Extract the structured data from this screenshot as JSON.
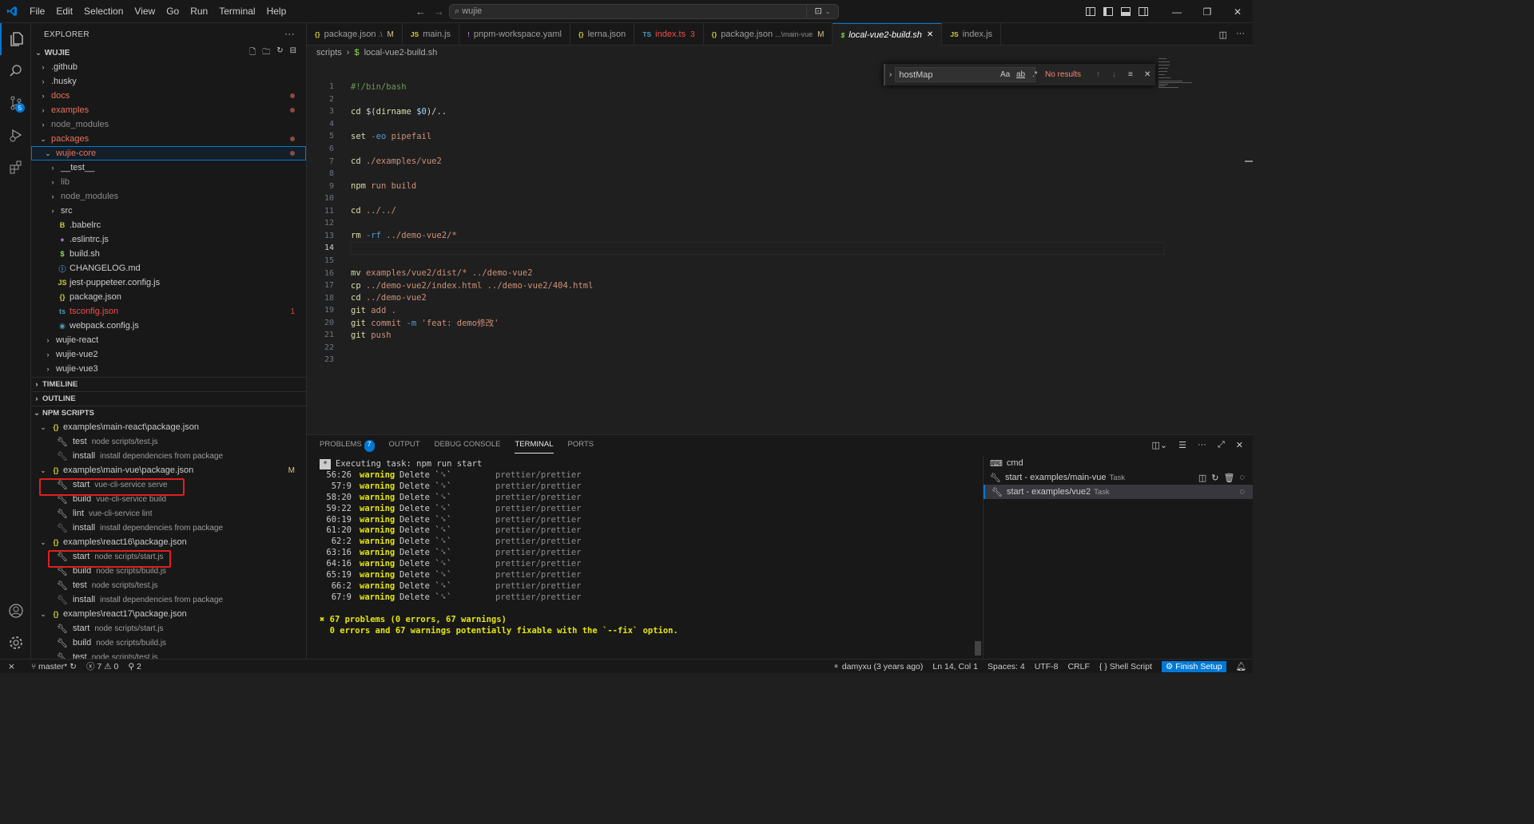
{
  "menu": [
    "File",
    "Edit",
    "Selection",
    "View",
    "Go",
    "Run",
    "Terminal",
    "Help"
  ],
  "command_center": "wujie",
  "explorer": {
    "title": "EXPLORER",
    "root": "WUJIE",
    "items": [
      {
        "label": ".github",
        "chev": ">",
        "indent": 0
      },
      {
        "label": ".husky",
        "chev": ">",
        "indent": 0
      },
      {
        "label": "docs",
        "chev": ">",
        "indent": 0,
        "modified": true
      },
      {
        "label": "examples",
        "chev": ">",
        "indent": 0,
        "modified": true
      },
      {
        "label": "node_modules",
        "chev": ">",
        "indent": 0,
        "dim": true
      },
      {
        "label": "packages",
        "chev": "v",
        "indent": 0,
        "modified": true
      },
      {
        "label": "wujie-core",
        "chev": "v",
        "indent": 1,
        "modified": true,
        "selected": true
      },
      {
        "label": "__test__",
        "chev": ">",
        "indent": 2
      },
      {
        "label": "lib",
        "chev": ">",
        "indent": 2,
        "dim": true
      },
      {
        "label": "node_modules",
        "chev": ">",
        "indent": 2,
        "dim": true
      },
      {
        "label": "src",
        "chev": ">",
        "indent": 2
      },
      {
        "label": ".babelrc",
        "icon": "B",
        "iconColor": "#cbcb41",
        "indent": 2
      },
      {
        "label": ".eslintrc.js",
        "icon": "●",
        "iconColor": "#a074c4",
        "indent": 2
      },
      {
        "label": "build.sh",
        "icon": "$",
        "iconColor": "#89e051",
        "indent": 2
      },
      {
        "label": "CHANGELOG.md",
        "icon": "ⓘ",
        "iconColor": "#519aba",
        "indent": 2
      },
      {
        "label": "jest-puppeteer.config.js",
        "icon": "JS",
        "iconColor": "#cbcb41",
        "indent": 2
      },
      {
        "label": "package.json",
        "icon": "{}",
        "iconColor": "#cbcb41",
        "indent": 2
      },
      {
        "label": "tsconfig.json",
        "icon": "ts",
        "iconColor": "#519aba",
        "indent": 2,
        "error": "1"
      },
      {
        "label": "webpack.config.js",
        "icon": "◉",
        "iconColor": "#519aba",
        "indent": 2
      },
      {
        "label": "wujie-react",
        "chev": ">",
        "indent": 1
      },
      {
        "label": "wujie-vue2",
        "chev": ">",
        "indent": 1
      },
      {
        "label": "wujie-vue3",
        "chev": ">",
        "indent": 1
      }
    ]
  },
  "sections": {
    "timeline": "TIMELINE",
    "outline": "OUTLINE",
    "npm": "NPM SCRIPTS"
  },
  "npm_scripts": [
    {
      "pkg": "examples\\main-react\\package.json",
      "status": "",
      "scripts": [
        {
          "name": "test",
          "cmd": "node scripts/test.js"
        },
        {
          "name": "install",
          "cmd": "install dependencies from package",
          "dim": true
        }
      ]
    },
    {
      "pkg": "examples\\main-vue\\package.json",
      "status": "M",
      "scripts": [
        {
          "name": "start",
          "cmd": "vue-cli-service serve",
          "highlight": true
        },
        {
          "name": "build",
          "cmd": "vue-cli-service build"
        },
        {
          "name": "lint",
          "cmd": "vue-cli-service lint"
        },
        {
          "name": "install",
          "cmd": "install dependencies from package",
          "dim": true
        }
      ]
    },
    {
      "pkg": "examples\\react16\\package.json",
      "status": "",
      "scripts": [
        {
          "name": "start",
          "cmd": "node scripts/start.js",
          "highlight": true
        },
        {
          "name": "build",
          "cmd": "node scripts/build.js"
        },
        {
          "name": "test",
          "cmd": "node scripts/test.js"
        },
        {
          "name": "install",
          "cmd": "install dependencies from package",
          "dim": true
        }
      ]
    },
    {
      "pkg": "examples\\react17\\package.json",
      "status": "",
      "scripts": [
        {
          "name": "start",
          "cmd": "node scripts/start.js"
        },
        {
          "name": "build",
          "cmd": "node scripts/build.js"
        },
        {
          "name": "test",
          "cmd": "node scripts/test.js"
        }
      ]
    }
  ],
  "tabs": [
    {
      "icon": "{}",
      "iconColor": "#cbcb41",
      "label": "package.json",
      "sub": ".\\",
      "mark": "M",
      "markColor": "#e2c08d"
    },
    {
      "icon": "JS",
      "iconColor": "#cbcb41",
      "label": "main.js"
    },
    {
      "icon": "!",
      "iconColor": "#a074c4",
      "label": "pnpm-workspace.yaml"
    },
    {
      "icon": "{}",
      "iconColor": "#cbcb41",
      "label": "lerna.json"
    },
    {
      "icon": "TS",
      "iconColor": "#519aba",
      "label": "index.ts",
      "mark": "3",
      "markColor": "#f14c4c",
      "labelColor": "#f14c4c"
    },
    {
      "icon": "{}",
      "iconColor": "#cbcb41",
      "label": "package.json",
      "sub": "...\\main-vue",
      "mark": "M",
      "markColor": "#e2c08d"
    },
    {
      "icon": "$",
      "iconColor": "#89e051",
      "label": "local-vue2-build.sh",
      "active": true,
      "mark": "✕",
      "markColor": "#ffffff"
    },
    {
      "icon": "JS",
      "iconColor": "#cbcb41",
      "label": "index.js"
    }
  ],
  "breadcrumb": [
    "scripts",
    "local-vue2-build.sh"
  ],
  "find": {
    "value": "hostMap",
    "result": "No results",
    "case": "Aa",
    "word": "ab",
    "regex": ".*"
  },
  "code": [
    {
      "n": "1",
      "segs": [
        {
          "t": "#!/bin/bash",
          "c": "cm"
        }
      ]
    },
    {
      "n": "2",
      "segs": []
    },
    {
      "n": "3",
      "segs": [
        {
          "t": "cd ",
          "c": "fn"
        },
        {
          "t": "$(",
          "c": "op"
        },
        {
          "t": "dirname ",
          "c": "fn"
        },
        {
          "t": "$0",
          "c": "vr"
        },
        {
          "t": ")/..",
          "c": "op"
        }
      ]
    },
    {
      "n": "4",
      "segs": []
    },
    {
      "n": "5",
      "segs": [
        {
          "t": "set ",
          "c": "fn"
        },
        {
          "t": "-eo ",
          "c": "kw"
        },
        {
          "t": "pipefail",
          "c": "str"
        }
      ]
    },
    {
      "n": "6",
      "segs": []
    },
    {
      "n": "7",
      "segs": [
        {
          "t": "cd ",
          "c": "fn"
        },
        {
          "t": "./examples/vue2",
          "c": "str"
        }
      ]
    },
    {
      "n": "8",
      "segs": []
    },
    {
      "n": "9",
      "segs": [
        {
          "t": "npm ",
          "c": "fn"
        },
        {
          "t": "run build",
          "c": "str"
        }
      ]
    },
    {
      "n": "10",
      "segs": []
    },
    {
      "n": "11",
      "segs": [
        {
          "t": "cd ",
          "c": "fn"
        },
        {
          "t": "../../",
          "c": "str"
        }
      ]
    },
    {
      "n": "12",
      "segs": []
    },
    {
      "n": "13",
      "segs": [
        {
          "t": "rm ",
          "c": "fn"
        },
        {
          "t": "-rf ",
          "c": "kw"
        },
        {
          "t": "../demo-vue2/*",
          "c": "str"
        }
      ]
    },
    {
      "n": "14",
      "segs": [],
      "current": true
    },
    {
      "n": "15",
      "segs": []
    },
    {
      "n": "16",
      "segs": [
        {
          "t": "mv ",
          "c": "fn"
        },
        {
          "t": "examples/vue2/dist/* ../demo-vue2",
          "c": "str"
        }
      ]
    },
    {
      "n": "17",
      "segs": [
        {
          "t": "cp ",
          "c": "fn"
        },
        {
          "t": "../demo-vue2/index.html ../demo-vue2/404.html",
          "c": "str"
        }
      ]
    },
    {
      "n": "18",
      "segs": [
        {
          "t": "cd ",
          "c": "fn"
        },
        {
          "t": "../demo-vue2",
          "c": "str"
        }
      ]
    },
    {
      "n": "19",
      "segs": [
        {
          "t": "git ",
          "c": "fn"
        },
        {
          "t": "add .",
          "c": "str"
        }
      ]
    },
    {
      "n": "20",
      "segs": [
        {
          "t": "git ",
          "c": "fn"
        },
        {
          "t": "commit ",
          "c": "str"
        },
        {
          "t": "-m ",
          "c": "kw"
        },
        {
          "t": "'feat: demo修改'",
          "c": "str"
        }
      ]
    },
    {
      "n": "21",
      "segs": [
        {
          "t": "git ",
          "c": "fn"
        },
        {
          "t": "push",
          "c": "str"
        }
      ]
    },
    {
      "n": "22",
      "segs": []
    },
    {
      "n": "23",
      "segs": []
    }
  ],
  "panel": {
    "tabs": [
      {
        "label": "PROBLEMS",
        "badge": "7"
      },
      {
        "label": "OUTPUT"
      },
      {
        "label": "DEBUG CONSOLE"
      },
      {
        "label": "TERMINAL",
        "active": true
      },
      {
        "label": "PORTS"
      }
    ],
    "task_header": "Executing task: npm run start",
    "warnings": [
      {
        "pos": "56:26",
        "rule": "prettier/prettier"
      },
      {
        "pos": "57:9",
        "rule": "prettier/prettier"
      },
      {
        "pos": "58:20",
        "rule": "prettier/prettier"
      },
      {
        "pos": "59:22",
        "rule": "prettier/prettier"
      },
      {
        "pos": "60:19",
        "rule": "prettier/prettier"
      },
      {
        "pos": "61:20",
        "rule": "prettier/prettier"
      },
      {
        "pos": "62:2",
        "rule": "prettier/prettier"
      },
      {
        "pos": "63:16",
        "rule": "prettier/prettier"
      },
      {
        "pos": "64:16",
        "rule": "prettier/prettier"
      },
      {
        "pos": "65:19",
        "rule": "prettier/prettier"
      },
      {
        "pos": "66:2",
        "rule": "prettier/prettier"
      },
      {
        "pos": "67:9",
        "rule": "prettier/prettier"
      }
    ],
    "warning_label": "warning",
    "delete_label": "Delete `␍`",
    "summary1": "✖ 67 problems (0 errors, 67 warnings)",
    "summary2": "  0 errors and 67 warnings potentially fixable with the `--fix` option.",
    "terminals": [
      {
        "label": "cmd",
        "tag": ""
      },
      {
        "label": "start - examples/main-vue",
        "tag": "Task"
      },
      {
        "label": "start - examples/vue2",
        "tag": "Task",
        "selected": true
      }
    ]
  },
  "status": {
    "branch": "master*",
    "errors": "7",
    "warnings": "0",
    "ports": "2",
    "blame": "damyxu (3 years ago)",
    "position": "Ln 14, Col 1",
    "spaces": "Spaces: 4",
    "encoding": "UTF-8",
    "eol": "CRLF",
    "language": "Shell Script",
    "setup": "Finish Setup"
  },
  "colors": {
    "accent": "#0078d4",
    "warning": "#e5e510",
    "highlight_box": "#e0201b"
  }
}
